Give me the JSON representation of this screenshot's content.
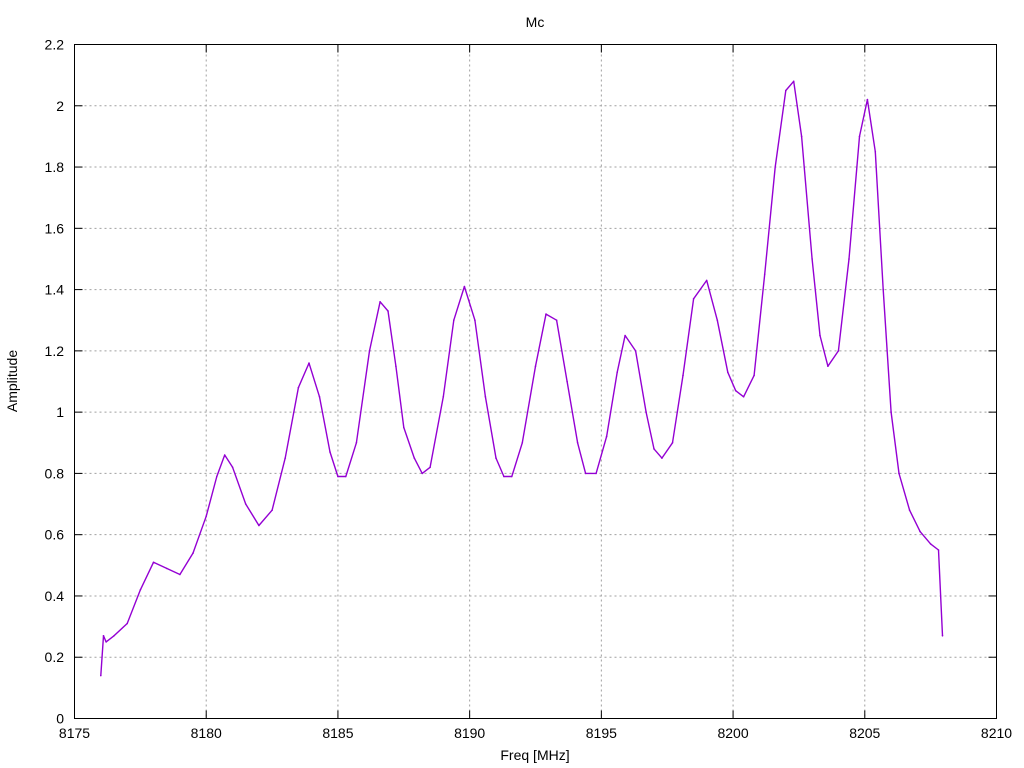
{
  "chart_data": {
    "type": "line",
    "title": "Mc",
    "xlabel": "Freq [MHz]",
    "ylabel": "Amplitude",
    "xlim": [
      8175,
      8210
    ],
    "ylim": [
      0,
      2.2
    ],
    "grid": true,
    "x_ticks": [
      "8175",
      "8180",
      "8185",
      "8190",
      "8195",
      "8200",
      "8205",
      "8210"
    ],
    "y_ticks": [
      "0",
      "0.2",
      "0.4",
      "0.6",
      "0.8",
      "1",
      "1.2",
      "1.4",
      "1.6",
      "1.8",
      "2",
      "2.2"
    ],
    "series": [
      {
        "color": "#9400d3",
        "x": [
          8176.0,
          8176.1,
          8176.2,
          8176.5,
          8177.0,
          8177.5,
          8178.0,
          8178.5,
          8179.0,
          8179.5,
          8180.0,
          8180.4,
          8180.7,
          8181.0,
          8181.5,
          8182.0,
          8182.5,
          8183.0,
          8183.5,
          8183.9,
          8184.3,
          8184.7,
          8185.0,
          8185.3,
          8185.7,
          8186.2,
          8186.6,
          8186.9,
          8187.2,
          8187.5,
          8187.9,
          8188.2,
          8188.5,
          8189.0,
          8189.4,
          8189.8,
          8190.2,
          8190.6,
          8191.0,
          8191.3,
          8191.6,
          8192.0,
          8192.5,
          8192.9,
          8193.3,
          8193.7,
          8194.1,
          8194.4,
          8194.8,
          8195.2,
          8195.6,
          8195.9,
          8196.3,
          8196.7,
          8197.0,
          8197.3,
          8197.7,
          8198.1,
          8198.5,
          8199.0,
          8199.4,
          8199.8,
          8200.1,
          8200.4,
          8200.8,
          8201.2,
          8201.6,
          8202.0,
          8202.3,
          8202.6,
          8203.0,
          8203.3,
          8203.6,
          8204.0,
          8204.4,
          8204.8,
          8205.1,
          8205.4,
          8205.7,
          8206.0,
          8206.3,
          8206.7,
          8207.1,
          8207.5,
          8207.8,
          8207.95
        ],
        "y": [
          0.14,
          0.27,
          0.25,
          0.27,
          0.31,
          0.42,
          0.51,
          0.49,
          0.47,
          0.54,
          0.66,
          0.79,
          0.86,
          0.82,
          0.7,
          0.63,
          0.68,
          0.85,
          1.08,
          1.16,
          1.05,
          0.87,
          0.79,
          0.79,
          0.9,
          1.2,
          1.36,
          1.33,
          1.15,
          0.95,
          0.85,
          0.8,
          0.82,
          1.05,
          1.3,
          1.41,
          1.3,
          1.05,
          0.85,
          0.79,
          0.79,
          0.9,
          1.15,
          1.32,
          1.3,
          1.1,
          0.9,
          0.8,
          0.8,
          0.92,
          1.13,
          1.25,
          1.2,
          1.0,
          0.88,
          0.85,
          0.9,
          1.12,
          1.37,
          1.43,
          1.3,
          1.13,
          1.07,
          1.05,
          1.12,
          1.45,
          1.8,
          2.05,
          2.08,
          1.9,
          1.5,
          1.25,
          1.15,
          1.2,
          1.5,
          1.9,
          2.02,
          1.85,
          1.4,
          1.0,
          0.8,
          0.68,
          0.61,
          0.57,
          0.55,
          0.27
        ]
      }
    ]
  }
}
